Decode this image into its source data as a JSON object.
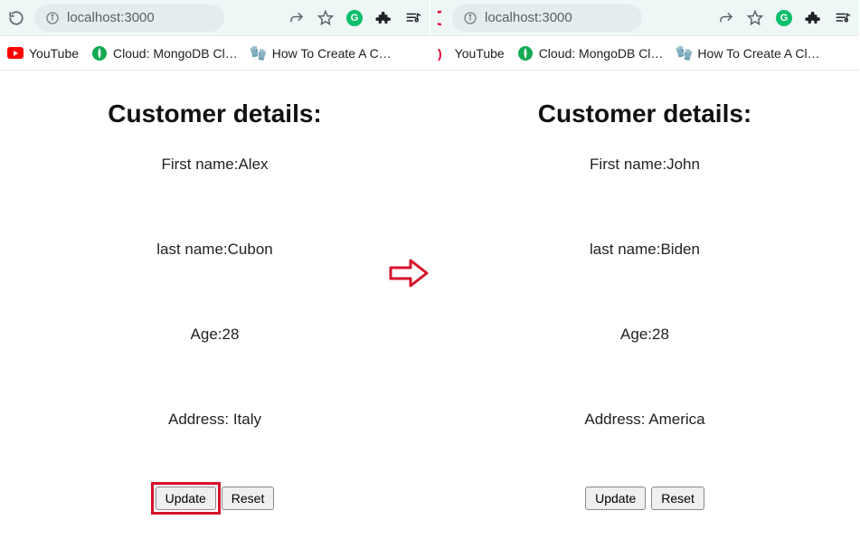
{
  "browser": {
    "url": "localhost:3000",
    "bookmarks": {
      "youtube": "YouTube",
      "mongo": "Cloud: MongoDB Cl…",
      "howto_left": "How To Create A C…",
      "howto_right": "How To Create A Cl…"
    }
  },
  "labels": {
    "heading": "Customer details:",
    "first_name": "First name:",
    "last_name": "last name:",
    "age": "Age:",
    "address": "Address: ",
    "update_btn": "Update",
    "reset_btn": "Reset"
  },
  "left": {
    "first_name": "Alex",
    "last_name": "Cubon",
    "age": "28",
    "address": "Italy"
  },
  "right": {
    "first_name": "John",
    "last_name": "Biden",
    "age": "28",
    "address": "America"
  }
}
